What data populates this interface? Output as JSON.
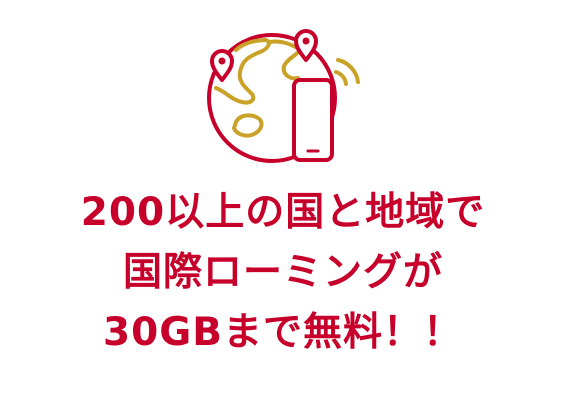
{
  "headline": {
    "line1": "200以上の国と地域で",
    "line2": "国際ローミングが",
    "line3": "30GBまで無料！！"
  },
  "illustration": {
    "icons": [
      "globe-icon",
      "map-pin-icon",
      "smartphone-icon",
      "signal-waves-icon"
    ]
  },
  "colors": {
    "accent": "#c7002b",
    "gold": "#c9a227",
    "background": "#ffffff"
  }
}
